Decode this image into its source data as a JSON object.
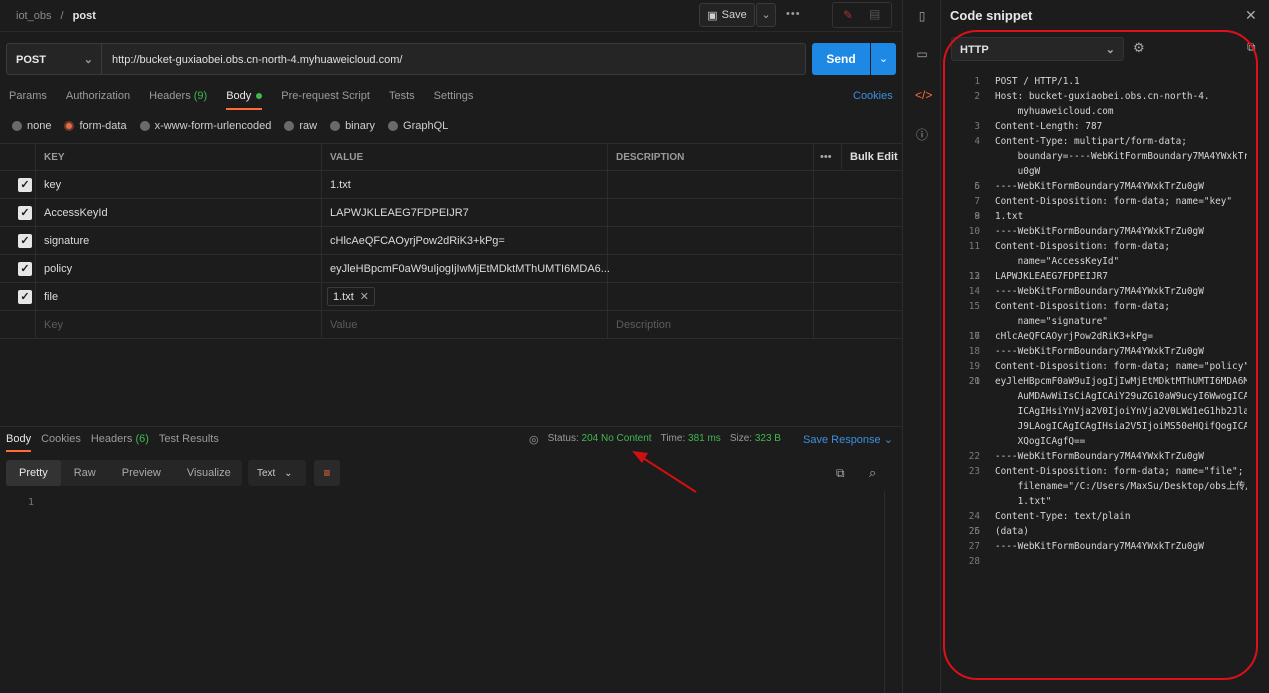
{
  "breadcrumb": {
    "parent": "iot_obs",
    "separator": "/",
    "current": "post"
  },
  "toolbar": {
    "save_label": "Save",
    "more": "•••"
  },
  "request": {
    "method": "POST",
    "url": "http://bucket-guxiaobei.obs.cn-north-4.myhuaweicloud.com/",
    "send_label": "Send"
  },
  "request_tabs": [
    {
      "label": "Params"
    },
    {
      "label": "Authorization"
    },
    {
      "label": "Headers",
      "count": "(9)"
    },
    {
      "label": "Body"
    },
    {
      "label": "Pre-request Script"
    },
    {
      "label": "Tests"
    },
    {
      "label": "Settings"
    }
  ],
  "cookies_link": "Cookies",
  "body_types": [
    "none",
    "form-data",
    "x-www-form-urlencoded",
    "raw",
    "binary",
    "GraphQL"
  ],
  "body_type_selected": "form-data",
  "table": {
    "headers": {
      "key": "KEY",
      "value": "VALUE",
      "description": "DESCRIPTION",
      "more": "•••",
      "bulk": "Bulk Edit"
    },
    "rows": [
      {
        "key": "key",
        "value": "1.txt"
      },
      {
        "key": "AccessKeyId",
        "value": "LAPWJKLEAEG7FDPEIJR7"
      },
      {
        "key": "signature",
        "value": "cHlcAeQFCAOyrjPow2dRiK3+kPg="
      },
      {
        "key": "policy",
        "value": "eyJleHBpcmF0aW9uIjogIjIwMjEtMDktMThUMTI6MDA6..."
      },
      {
        "key": "file",
        "value": "1.txt"
      }
    ],
    "placeholders": {
      "key": "Key",
      "value": "Value",
      "description": "Description"
    }
  },
  "response": {
    "tabs": [
      {
        "label": "Body"
      },
      {
        "label": "Cookies"
      },
      {
        "label": "Headers",
        "count": "(6)"
      },
      {
        "label": "Test Results"
      }
    ],
    "status_label": "Status:",
    "status_value": "204 No Content",
    "time_label": "Time:",
    "time_value": "381 ms",
    "size_label": "Size:",
    "size_value": "323 B",
    "save_response": "Save Response",
    "views": [
      "Pretty",
      "Raw",
      "Preview",
      "Visualize"
    ],
    "format": "Text",
    "line1": "1"
  },
  "snippet": {
    "title": "Code snippet",
    "language": "HTTP",
    "lines": [
      {
        "n": "1",
        "t": "POST / HTTP/1.1"
      },
      {
        "n": "2",
        "t": "Host: bucket-guxiaobei.obs.cn-north-4."
      },
      {
        "n": "",
        "t": "    myhuaweicloud.com"
      },
      {
        "n": "3",
        "t": "Content-Length: 787"
      },
      {
        "n": "4",
        "t": "Content-Type: multipart/form-data;"
      },
      {
        "n": "",
        "t": "    boundary=----WebKitFormBoundary7MA4YWxkTrZ"
      },
      {
        "n": "",
        "t": "    u0gW"
      },
      {
        "n": "5",
        "t": ""
      },
      {
        "n": "6",
        "t": "----WebKitFormBoundary7MA4YWxkTrZu0gW"
      },
      {
        "n": "7",
        "t": "Content-Disposition: form-data; name=\"key\""
      },
      {
        "n": "8",
        "t": ""
      },
      {
        "n": "9",
        "t": "1.txt"
      },
      {
        "n": "10",
        "t": "----WebKitFormBoundary7MA4YWxkTrZu0gW"
      },
      {
        "n": "11",
        "t": "Content-Disposition: form-data;"
      },
      {
        "n": "",
        "t": "    name=\"AccessKeyId\""
      },
      {
        "n": "12",
        "t": ""
      },
      {
        "n": "13",
        "t": "LAPWJKLEAEG7FDPEIJR7"
      },
      {
        "n": "14",
        "t": "----WebKitFormBoundary7MA4YWxkTrZu0gW"
      },
      {
        "n": "15",
        "t": "Content-Disposition: form-data;"
      },
      {
        "n": "",
        "t": "    name=\"signature\""
      },
      {
        "n": "16",
        "t": ""
      },
      {
        "n": "17",
        "t": "cHlcAeQFCAOyrjPow2dRiK3+kPg="
      },
      {
        "n": "18",
        "t": "----WebKitFormBoundary7MA4YWxkTrZu0gW"
      },
      {
        "n": "19",
        "t": "Content-Disposition: form-data; name=\"policy\""
      },
      {
        "n": "20",
        "t": ""
      },
      {
        "n": "21",
        "t": "eyJleHBpcmF0aW9uIjogIjIwMjEtMDktMThUMTI6MDA6MD"
      },
      {
        "n": "",
        "t": "    AuMDAwWiIsCiAgICAiY29uZG10aW9ucyI6WwogICAg"
      },
      {
        "n": "",
        "t": "    ICAgIHsiYnVja2V0IjoiYnVja2V0LWd1eG1hb2JlaS"
      },
      {
        "n": "",
        "t": "    J9LAogICAgICAgIHsia2V5IjoiMS50eHQifQogICAg"
      },
      {
        "n": "",
        "t": "    XQogICAgfQ=="
      },
      {
        "n": "22",
        "t": "----WebKitFormBoundary7MA4YWxkTrZu0gW"
      },
      {
        "n": "23",
        "t": "Content-Disposition: form-data; name=\"file\";"
      },
      {
        "n": "",
        "t": "    filename=\"/C:/Users/MaxSu/Desktop/obs上传/"
      },
      {
        "n": "",
        "t": "    1.txt\""
      },
      {
        "n": "24",
        "t": "Content-Type: text/plain"
      },
      {
        "n": "25",
        "t": ""
      },
      {
        "n": "26",
        "t": "(data)"
      },
      {
        "n": "27",
        "t": "----WebKitFormBoundary7MA4YWxkTrZu0gW"
      },
      {
        "n": "28",
        "t": ""
      }
    ]
  },
  "colors": {
    "accent": "#ff6c37",
    "send": "#1e88e5",
    "ok": "#3fb950",
    "link": "#3d8fe0",
    "annotation": "#e0101a"
  }
}
